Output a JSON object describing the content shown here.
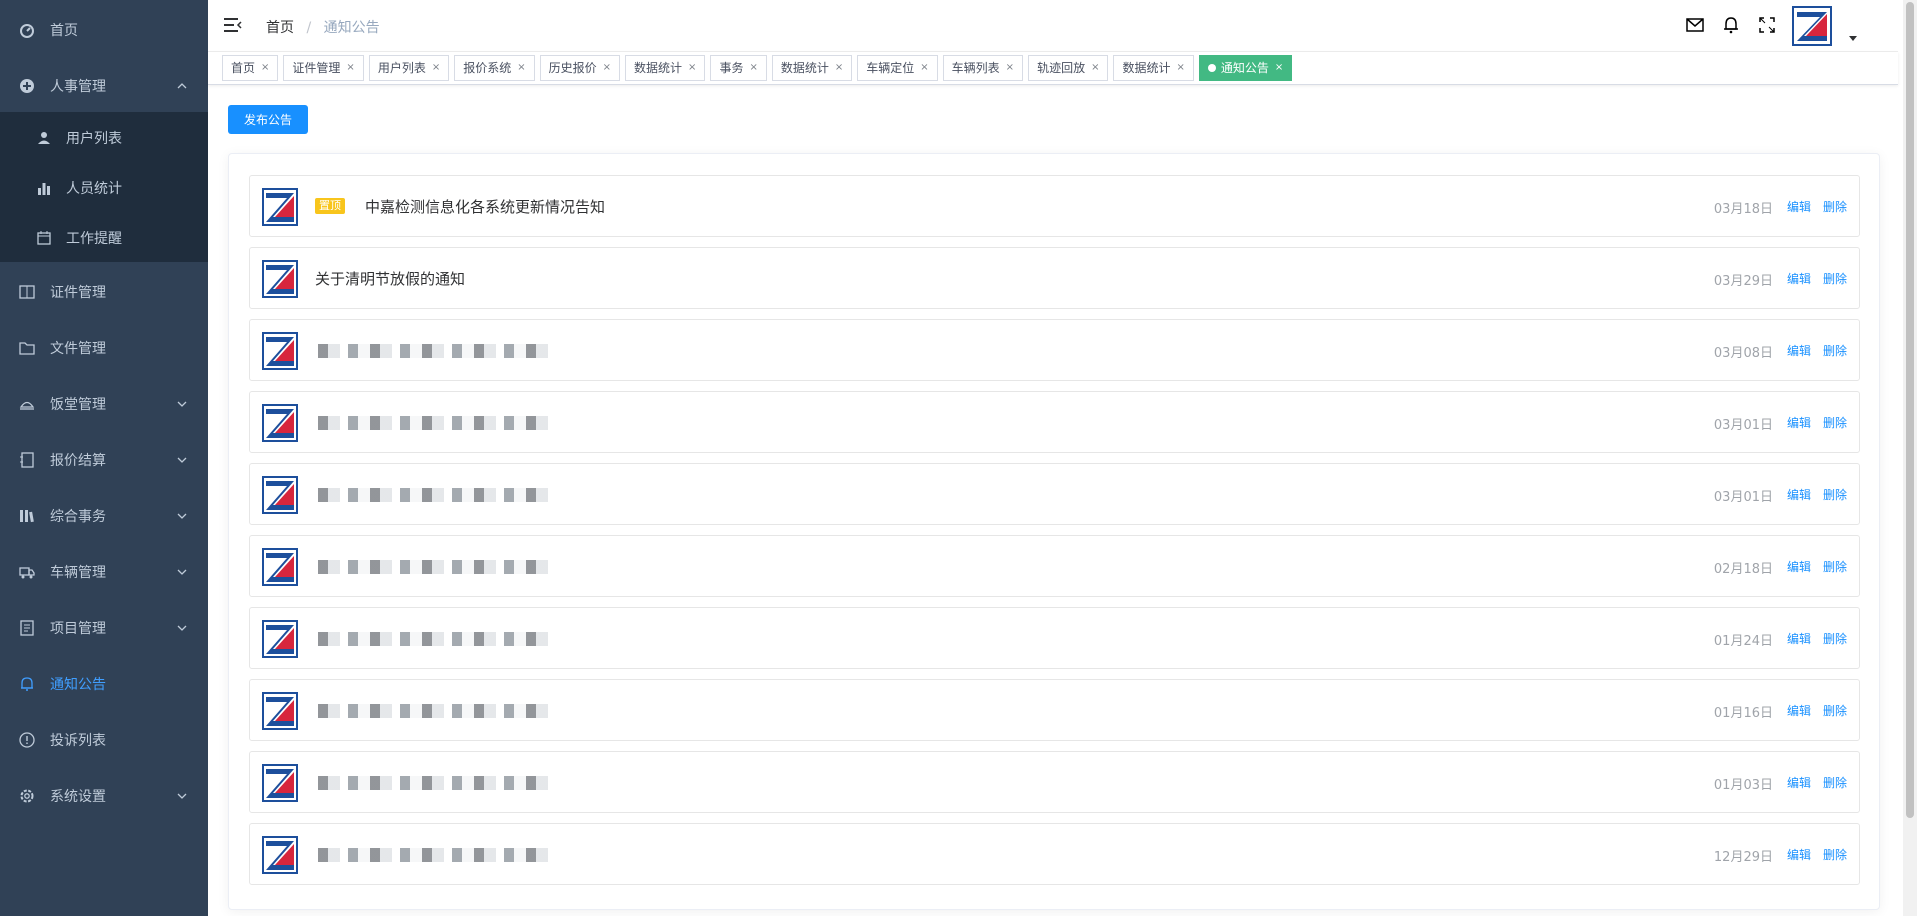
{
  "sidebar": {
    "items": [
      {
        "label": "首页",
        "icon": "dashboard-icon"
      },
      {
        "label": "人事管理",
        "icon": "plus-circle-icon"
      },
      {
        "label": "证件管理",
        "icon": "book-icon"
      },
      {
        "label": "文件管理",
        "icon": "folder-icon"
      },
      {
        "label": "饭堂管理",
        "icon": "dish-icon"
      },
      {
        "label": "报价结算",
        "icon": "notebook-icon"
      },
      {
        "label": "综合事务",
        "icon": "library-icon"
      },
      {
        "label": "车辆管理",
        "icon": "truck-icon"
      },
      {
        "label": "项目管理",
        "icon": "document-icon"
      },
      {
        "label": "通知公告",
        "icon": "bell-icon"
      },
      {
        "label": "投诉列表",
        "icon": "warning-circle-icon"
      },
      {
        "label": "系统设置",
        "icon": "gear-icon"
      }
    ],
    "subitems": [
      {
        "label": "用户列表",
        "icon": "user-icon"
      },
      {
        "label": "人员统计",
        "icon": "bar-chart-icon"
      },
      {
        "label": "工作提醒",
        "icon": "calendar-icon"
      }
    ]
  },
  "header": {
    "breadcrumb_home": "首页",
    "breadcrumb_sep": "/",
    "breadcrumb_current": "通知公告"
  },
  "tags": [
    {
      "label": "首页"
    },
    {
      "label": "证件管理"
    },
    {
      "label": "用户列表"
    },
    {
      "label": "报价系统"
    },
    {
      "label": "历史报价"
    },
    {
      "label": "数据统计"
    },
    {
      "label": "事务"
    },
    {
      "label": "数据统计"
    },
    {
      "label": "车辆定位"
    },
    {
      "label": "车辆列表"
    },
    {
      "label": "轨迹回放"
    },
    {
      "label": "数据统计"
    },
    {
      "label": "通知公告"
    }
  ],
  "tag_close": "×",
  "main": {
    "publish_label": "发布公告",
    "pin_label": "置顶",
    "edit_label": "编辑",
    "delete_label": "删除",
    "notices": [
      {
        "title": "中嘉检测信息化各系统更新情况告知",
        "date": "03月18日"
      },
      {
        "title": "关于清明节放假的通知",
        "date": "03月29日"
      },
      {
        "title": "",
        "date": "03月08日"
      },
      {
        "title": "",
        "date": "03月01日"
      },
      {
        "title": "",
        "date": "03月01日"
      },
      {
        "title": "",
        "date": "02月18日"
      },
      {
        "title": "",
        "date": "01月24日"
      },
      {
        "title": "",
        "date": "01月16日"
      },
      {
        "title": "",
        "date": "01月03日"
      },
      {
        "title": "",
        "date": "12月29日"
      }
    ]
  },
  "colors": {
    "sidebar_bg": "#304156",
    "active": "#409EFF",
    "tag_active": "#42b983",
    "primary": "#1890ff"
  }
}
